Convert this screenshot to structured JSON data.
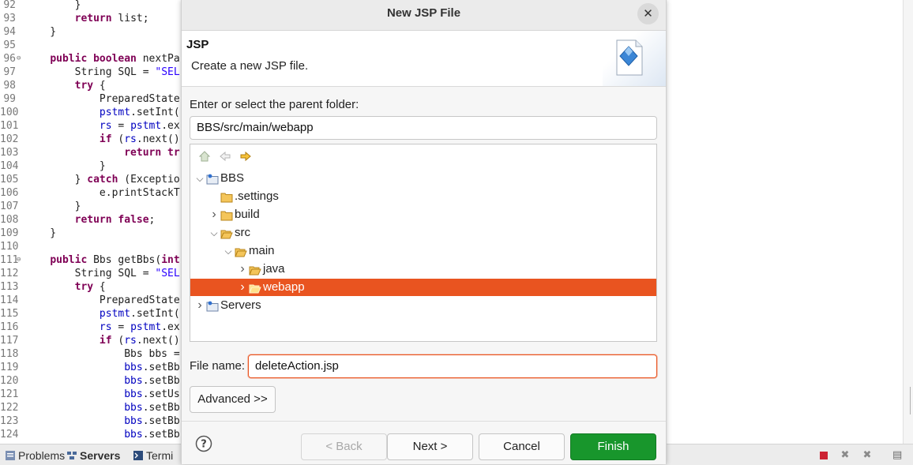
{
  "editor": {
    "lines": [
      {
        "num": "92",
        "fold": "",
        "html": "        }"
      },
      {
        "num": "93",
        "fold": "",
        "html": "        <span class='kw'>return</span> list;"
      },
      {
        "num": "94",
        "fold": "",
        "html": "    }"
      },
      {
        "num": "95",
        "fold": "",
        "html": ""
      },
      {
        "num": "96",
        "fold": "⊖",
        "html": "    <span class='kw'>public boolean</span> nextPa"
      },
      {
        "num": "97",
        "fold": "",
        "html": "        String SQL = <span class='str'>\"SEL</span>"
      },
      {
        "num": "98",
        "fold": "",
        "html": "        <span class='kw'>try</span> {"
      },
      {
        "num": "99",
        "fold": "",
        "html": "            PreparedState"
      },
      {
        "num": "100",
        "fold": "",
        "html": "            <span class='var'>pstmt</span>.setInt("
      },
      {
        "num": "101",
        "fold": "",
        "html": "            <span class='var'>rs</span> = <span class='var'>pstmt</span>.ex"
      },
      {
        "num": "102",
        "fold": "",
        "html": "            <span class='kw'>if</span> (<span class='var'>rs</span>.next()"
      },
      {
        "num": "103",
        "fold": "",
        "html": "                <span class='kw'>return tr</span>"
      },
      {
        "num": "104",
        "fold": "",
        "html": "            }"
      },
      {
        "num": "105",
        "fold": "",
        "html": "        } <span class='kw'>catch</span> (Exceptio"
      },
      {
        "num": "106",
        "fold": "",
        "html": "            e.printStackT"
      },
      {
        "num": "107",
        "fold": "",
        "html": "        }"
      },
      {
        "num": "108",
        "fold": "",
        "html": "        <span class='kw'>return false</span>;"
      },
      {
        "num": "109",
        "fold": "",
        "html": "    }"
      },
      {
        "num": "110",
        "fold": "",
        "html": ""
      },
      {
        "num": "111",
        "fold": "⊖",
        "html": "    <span class='kw'>public</span> Bbs getBbs(<span class='kw'>int</span>"
      },
      {
        "num": "112",
        "fold": "",
        "html": "        String SQL = <span class='str'>\"SEL</span>"
      },
      {
        "num": "113",
        "fold": "",
        "html": "        <span class='kw'>try</span> {"
      },
      {
        "num": "114",
        "fold": "",
        "html": "            PreparedState"
      },
      {
        "num": "115",
        "fold": "",
        "html": "            <span class='var'>pstmt</span>.setInt("
      },
      {
        "num": "116",
        "fold": "",
        "html": "            <span class='var'>rs</span> = <span class='var'>pstmt</span>.ex"
      },
      {
        "num": "117",
        "fold": "",
        "html": "            <span class='kw'>if</span> (<span class='var'>rs</span>.next()"
      },
      {
        "num": "118",
        "fold": "",
        "html": "                Bbs bbs ="
      },
      {
        "num": "119",
        "fold": "",
        "html": "                <span class='var'>bbs</span>.setBb"
      },
      {
        "num": "120",
        "fold": "",
        "html": "                <span class='var'>bbs</span>.setBb"
      },
      {
        "num": "121",
        "fold": "",
        "html": "                <span class='var'>bbs</span>.setUs"
      },
      {
        "num": "122",
        "fold": "",
        "html": "                <span class='var'>bbs</span>.setBb"
      },
      {
        "num": "123",
        "fold": "",
        "html": "                <span class='var'>bbs</span>.setBb"
      },
      {
        "num": "124",
        "fold": "",
        "html": "                <span class='var'>bbs</span>.setBb"
      }
    ]
  },
  "views_bar": {
    "tabs": [
      {
        "label": "Problems",
        "icon": "problems-icon"
      },
      {
        "label": "Servers",
        "icon": "servers-icon",
        "active": true
      },
      {
        "label": "Termi",
        "icon": "terminal-icon"
      }
    ]
  },
  "dialog": {
    "title": "New JSP File",
    "banner_title": "JSP",
    "banner_description": "Create a new JSP file.",
    "parent_folder_label": "Enter or select the parent folder:",
    "parent_folder_value": "BBS/src/main/webapp",
    "tree": [
      {
        "label": "BBS",
        "expanded": true,
        "icon": "project-icon"
      },
      {
        "label": ".settings",
        "icon": "folder-icon"
      },
      {
        "label": "build",
        "expanded": false,
        "icon": "folder-icon"
      },
      {
        "label": "src",
        "expanded": true,
        "icon": "folder-open-icon"
      },
      {
        "label": "main",
        "expanded": true,
        "icon": "folder-open-icon"
      },
      {
        "label": "java",
        "expanded": false,
        "icon": "folder-open-icon"
      },
      {
        "label": "webapp",
        "expanded": false,
        "selected": true,
        "icon": "folder-open-icon"
      },
      {
        "label": "Servers",
        "expanded": false,
        "icon": "project-icon"
      }
    ],
    "file_name_label": "File name:",
    "file_name_value": "deleteAction.jsp",
    "advanced_label": "Advanced >>",
    "buttons": {
      "back": "< Back",
      "next": "Next >",
      "cancel": "Cancel",
      "finish": "Finish"
    },
    "colors": {
      "selection": "#e95420",
      "finish": "#18962c"
    }
  }
}
